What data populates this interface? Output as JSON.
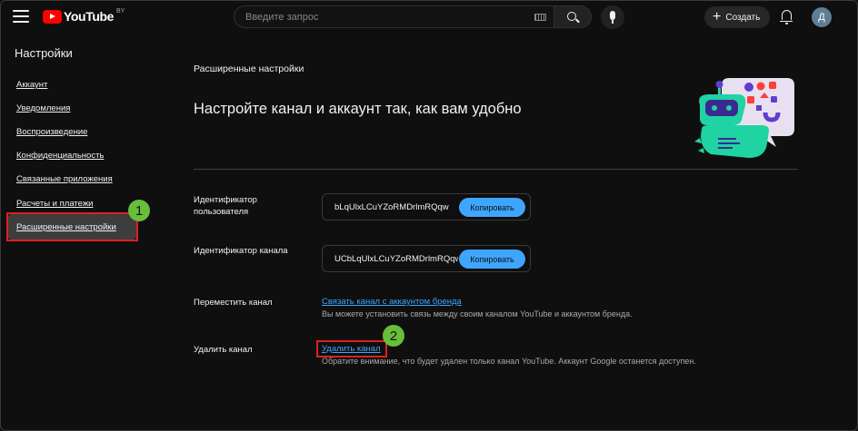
{
  "header": {
    "logo_text": "YouTube",
    "logo_country": "BY",
    "search_placeholder": "Введите запрос",
    "create_label": "Создать",
    "avatar_letter": "Д"
  },
  "sidebar": {
    "title": "Настройки",
    "items": [
      {
        "label": "Аккаунт"
      },
      {
        "label": "Уведомления"
      },
      {
        "label": "Воспроизведение"
      },
      {
        "label": "Конфиденциальность"
      },
      {
        "label": "Связанные приложения"
      },
      {
        "label": "Расчеты и платежи"
      },
      {
        "label": "Расширенные настройки"
      }
    ]
  },
  "main": {
    "section_title": "Расширенные настройки",
    "headline": "Настройте канал и аккаунт так, как вам удобно",
    "user_id": {
      "label": "Идентификатор пользователя",
      "value": "bLqUlxLCuYZoRMDrlmRQqw",
      "button": "Копировать"
    },
    "channel_id": {
      "label": "Идентификатор канала",
      "value": "UCbLqUlxLCuYZoRMDrlmRQqw",
      "button": "Копировать"
    },
    "move_channel": {
      "label": "Переместить канал",
      "link": "Связать канал с аккаунтом бренда",
      "hint": "Вы можете установить связь между своим каналом YouTube и аккаунтом бренда."
    },
    "delete_channel": {
      "label": "Удалить канал",
      "link": "Удалить канал",
      "hint": "Обратите внимание, что будет удален только канал YouTube. Аккаунт Google останется доступен."
    }
  },
  "annotations": {
    "marker_1": "1",
    "marker_2": "2",
    "highlight_color": "#e02020",
    "marker_color": "#67be3b"
  },
  "colors": {
    "background": "#0f0f0f",
    "accent": "#3ea6ff",
    "brand": "#ff0000"
  }
}
